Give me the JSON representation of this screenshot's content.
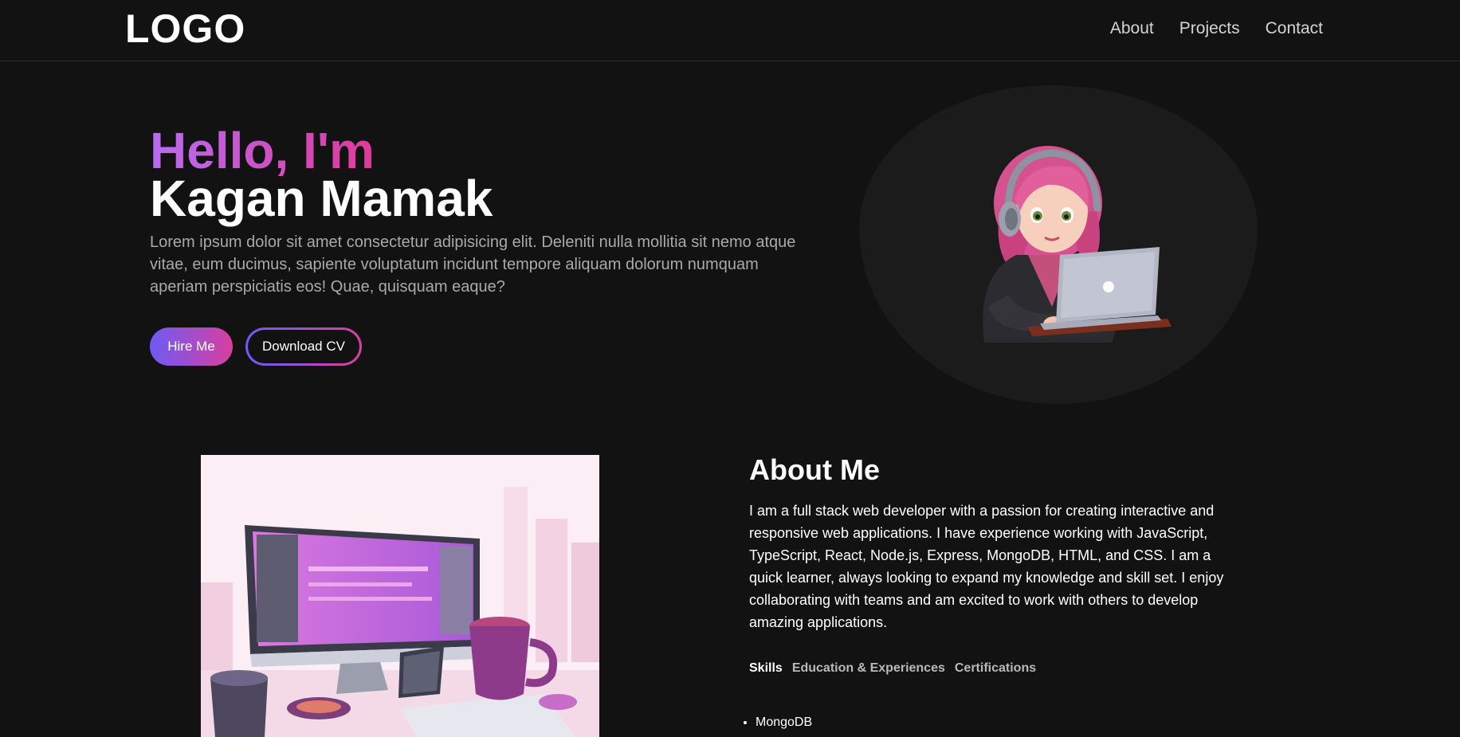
{
  "header": {
    "logo": "LOGO",
    "nav": [
      {
        "label": "About"
      },
      {
        "label": "Projects"
      },
      {
        "label": "Contact"
      }
    ]
  },
  "hero": {
    "greeting": "Hello, I'm",
    "name": "Kagan Mamak",
    "description": "Lorem ipsum dolor sit amet consectetur adipisicing elit. Deleniti nulla mollitia sit nemo atque vitae, eum ducimus, sapiente voluptatum incidunt tempore aliquam dolorum numquam aperiam perspiciatis eos! Quae, quisquam eaque?",
    "hire_button": "Hire Me",
    "cv_button": "Download CV",
    "avatar_icon": "avatar-girl-laptop-icon"
  },
  "about": {
    "title": "About Me",
    "text": "I am a full stack web developer with a passion for creating interactive and responsive web applications. I have experience working with JavaScript, TypeScript, React, Node.js, Express, MongoDB, HTML, and CSS. I am a quick learner, always looking to expand my knowledge and skill set. I enjoy collaborating with teams and am excited to work with others to develop amazing applications.",
    "tabs": [
      {
        "label": "Skills",
        "active": true
      },
      {
        "label": "Education & Experiences",
        "active": false
      },
      {
        "label": "Certifications",
        "active": false
      }
    ],
    "skills": [
      "MongoDB"
    ],
    "image_icon": "workspace-computer-illustration"
  },
  "colors": {
    "background": "#121212",
    "gradient_start": "#b86cf2",
    "gradient_end": "#e0399a",
    "button_gradient_start": "#6d5bf5",
    "button_gradient_end": "#d93f9e",
    "muted_text": "#a9a9a9"
  }
}
